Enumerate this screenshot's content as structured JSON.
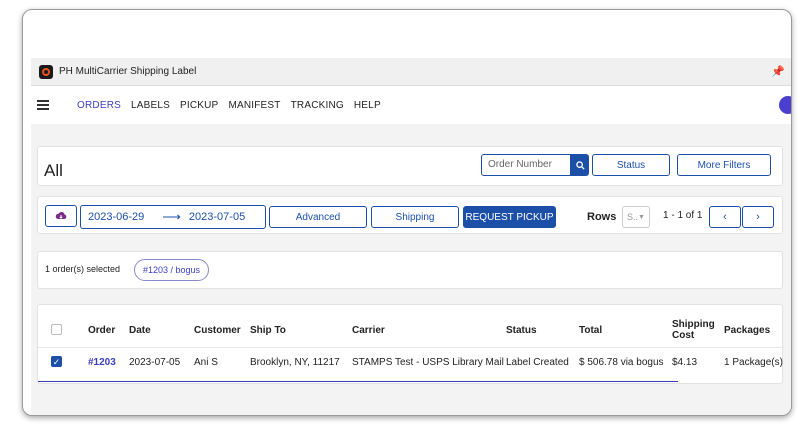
{
  "window": {
    "title": "PH MultiCarrier Shipping Label",
    "pin_icon": "pin-icon"
  },
  "nav": {
    "items": [
      {
        "label": "ORDERS",
        "active": true
      },
      {
        "label": "LABELS",
        "active": false
      },
      {
        "label": "PICKUP",
        "active": false
      },
      {
        "label": "MANIFEST",
        "active": false
      },
      {
        "label": "TRACKING",
        "active": false
      },
      {
        "label": "HELP",
        "active": false
      }
    ]
  },
  "filters": {
    "page_title": "All",
    "search_placeholder": "Order Number",
    "status_label": "Status",
    "more_filters_label": "More Filters"
  },
  "toolbar": {
    "date_from": "2023-06-29",
    "date_to": "2023-07-05",
    "advanced_label": "Advanced",
    "shipping_label": "Shipping",
    "request_pickup_label": "REQUEST PICKUP",
    "rows_label": "Rows",
    "rows_value": "S..",
    "pagination_text": "1 - 1 of 1"
  },
  "selection": {
    "count_text": "1 order(s) selected",
    "chip_label": "#1203 / bogus"
  },
  "table": {
    "headers": [
      "Order",
      "Date",
      "Customer",
      "Ship To",
      "Carrier",
      "Status",
      "Total",
      "Shipping Cost",
      "Packages"
    ],
    "shipping_cost_header_line1": "Shipping",
    "shipping_cost_header_line2": "Cost",
    "rows": [
      {
        "checked": true,
        "order": "#1203",
        "date": "2023-07-05",
        "customer": "Ani S",
        "ship_to": "Brooklyn, NY, 11217",
        "carrier": "STAMPS Test - USPS Library Mail",
        "status": "Label Created",
        "total": "$ 506.78 via bogus",
        "shipping_cost": "$4.13",
        "packages": "1 Package(s)"
      }
    ]
  },
  "colors": {
    "accent": "#1c4fa8",
    "link": "#3b3fbf"
  }
}
